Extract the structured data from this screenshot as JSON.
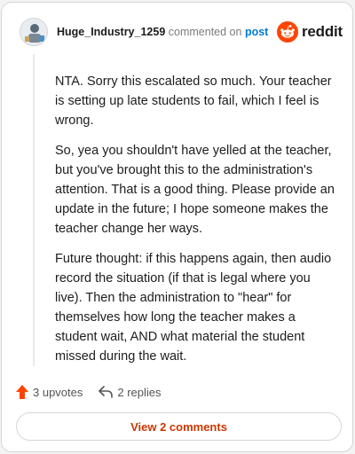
{
  "header": {
    "username": "Huge_Industry_1259",
    "action_text": "commented on",
    "post_link": "post",
    "brand_wordmark": "reddit",
    "brand_color": "#ff4500"
  },
  "comment": {
    "paragraphs": [
      "NTA. Sorry this escalated so much. Your teacher is setting up late students to fail, which I feel is wrong.",
      "So, yea you shouldn't have yelled at the teacher, but you've brought this to the administration's attention. That is a good thing. Please provide an update in the future; I hope someone makes the teacher change her ways.",
      "Future thought: if this happens again, then audio record the situation (if that is legal where you live). Then the administration to \"hear\" for themselves how long the teacher makes a student wait, AND what material the student missed during the wait."
    ]
  },
  "actions": {
    "upvotes_label": "3 upvotes",
    "replies_label": "2 replies"
  },
  "footer": {
    "view_comments_label": "View 2 comments",
    "accent_color": "#cc3700"
  }
}
